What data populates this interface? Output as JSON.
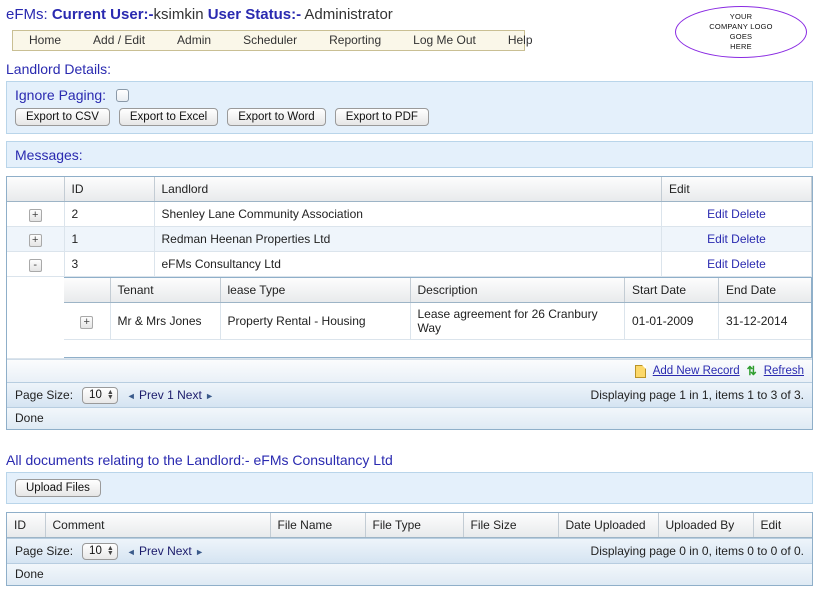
{
  "header": {
    "app_name": "eFMs:",
    "current_user_label": "Current User:-",
    "current_user": "ksimkin",
    "user_status_label": "User Status:-",
    "user_status": "Administrator",
    "nav": [
      {
        "label": "Home"
      },
      {
        "label": "Add / Edit"
      },
      {
        "label": "Admin"
      },
      {
        "label": "Scheduler"
      },
      {
        "label": "Reporting"
      },
      {
        "label": "Log Me Out"
      },
      {
        "label": "Help"
      }
    ],
    "logo": {
      "line1": "YOUR",
      "line2": "COMPANY LOGO",
      "line3": "GOES",
      "line4": "HERE",
      "border_color": "#8a2be2"
    }
  },
  "landlord_section": {
    "title": "Landlord Details:",
    "ignore_paging_label": "Ignore Paging:",
    "ignore_paging_checked": false,
    "export_buttons": [
      {
        "label": "Export to CSV"
      },
      {
        "label": "Export to Excel"
      },
      {
        "label": "Export to Word"
      },
      {
        "label": "Export to PDF"
      }
    ],
    "messages_label": "Messages:",
    "messages_text": "",
    "grid": {
      "columns": [
        "",
        "ID",
        "Landlord",
        "Edit"
      ],
      "rows": [
        {
          "expander": "+",
          "id": "2",
          "landlord": "Shenley Lane Community Association",
          "edit": "Edit",
          "delete": "Delete",
          "expanded": false
        },
        {
          "expander": "+",
          "id": "1",
          "landlord": "Redman Heenan Properties Ltd",
          "edit": "Edit",
          "delete": "Delete",
          "expanded": false
        },
        {
          "expander": "-",
          "id": "3",
          "landlord": "eFMs Consultancy Ltd",
          "edit": "Edit",
          "delete": "Delete",
          "expanded": true
        }
      ],
      "subgrid": {
        "columns": [
          "",
          "Tenant",
          "lease Type",
          "Description",
          "Start Date",
          "End Date"
        ],
        "rows": [
          {
            "expander": "+",
            "tenant": "Mr & Mrs Jones",
            "lease_type": "Property Rental - Housing",
            "description": "Lease agreement for 26 Cranbury Way",
            "start_date": "01-01-2009",
            "end_date": "31-12-2014"
          }
        ]
      },
      "toolbar": {
        "add_new_record": "Add New Record",
        "refresh": "Refresh",
        "add_icon": "page-icon",
        "refresh_icon": "refresh-icon"
      },
      "pager": {
        "page_size_label": "Page Size:",
        "page_size_value": "10",
        "prev": "Prev",
        "page_number": "1",
        "next": "Next",
        "status": "Displaying page 1 in 1, items 1 to 3 of 3."
      },
      "done_text": "Done"
    }
  },
  "documents_section": {
    "title": "All documents relating to the Landlord:- eFMs Consultancy Ltd",
    "upload_button": "Upload Files",
    "grid": {
      "columns": [
        "ID",
        "Comment",
        "File Name",
        "File Type",
        "File Size",
        "Date Uploaded",
        "Uploaded By",
        "Edit"
      ],
      "rows": [],
      "pager": {
        "page_size_label": "Page Size:",
        "page_size_value": "10",
        "prev": "Prev",
        "next": "Next",
        "status": "Displaying page 0 in 0, items 0 to 0 of 0."
      },
      "done_text": "Done"
    }
  }
}
